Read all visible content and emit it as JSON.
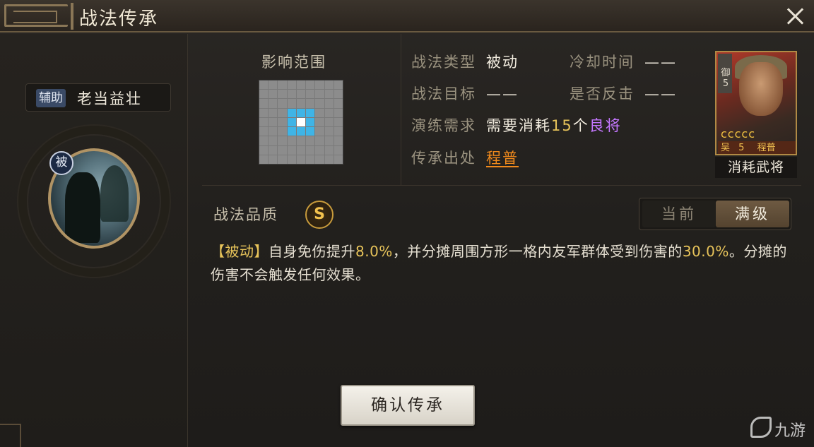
{
  "window": {
    "title": "战法传承"
  },
  "skill": {
    "role_tag": "辅助",
    "name": "老当益壮",
    "passive_badge": "被"
  },
  "range": {
    "title": "影响范围",
    "grid_size": 9,
    "highlight_blue": [
      [
        3,
        3
      ],
      [
        3,
        4
      ],
      [
        3,
        5
      ],
      [
        4,
        3
      ],
      [
        4,
        5
      ],
      [
        5,
        3
      ],
      [
        5,
        4
      ],
      [
        5,
        5
      ]
    ],
    "highlight_white": [
      [
        4,
        4
      ]
    ]
  },
  "info": {
    "type_label": "战法类型",
    "type_value": "被动",
    "cooldown_label": "冷却时间",
    "cooldown_value": "——",
    "target_label": "战法目标",
    "target_value": "——",
    "counter_label": "是否反击",
    "counter_value": "——",
    "practice_label": "演练需求",
    "practice_prefix": "需要消耗",
    "practice_count": "15",
    "practice_unit": "个",
    "practice_rarity": "良将",
    "source_label": "传承出处",
    "source_value": "程普"
  },
  "general_card": {
    "side_text": "御5",
    "stars": "ccccc",
    "faction": "吴",
    "cost": "5",
    "name": "程普",
    "caption": "消耗武将"
  },
  "quality": {
    "label": "战法品质",
    "grade": "S"
  },
  "toggle": {
    "current_label": "当前",
    "max_label": "满级"
  },
  "description": {
    "tag": "【被动】",
    "part1": "自身免伤提升",
    "value1": "8.0%",
    "part2": "，并分摊周围方形一格内友军群体受到伤害的",
    "value2": "30.0%",
    "part3": "。分摊的伤害不会触发任何效果。"
  },
  "actions": {
    "confirm_label": "确认传承"
  },
  "watermark": {
    "text": "九游"
  },
  "colors": {
    "accent_gold": "#e8c45a",
    "rarity_purple": "#c477ff",
    "link_orange": "#f08a1c",
    "range_blue": "#3fb4e6"
  }
}
